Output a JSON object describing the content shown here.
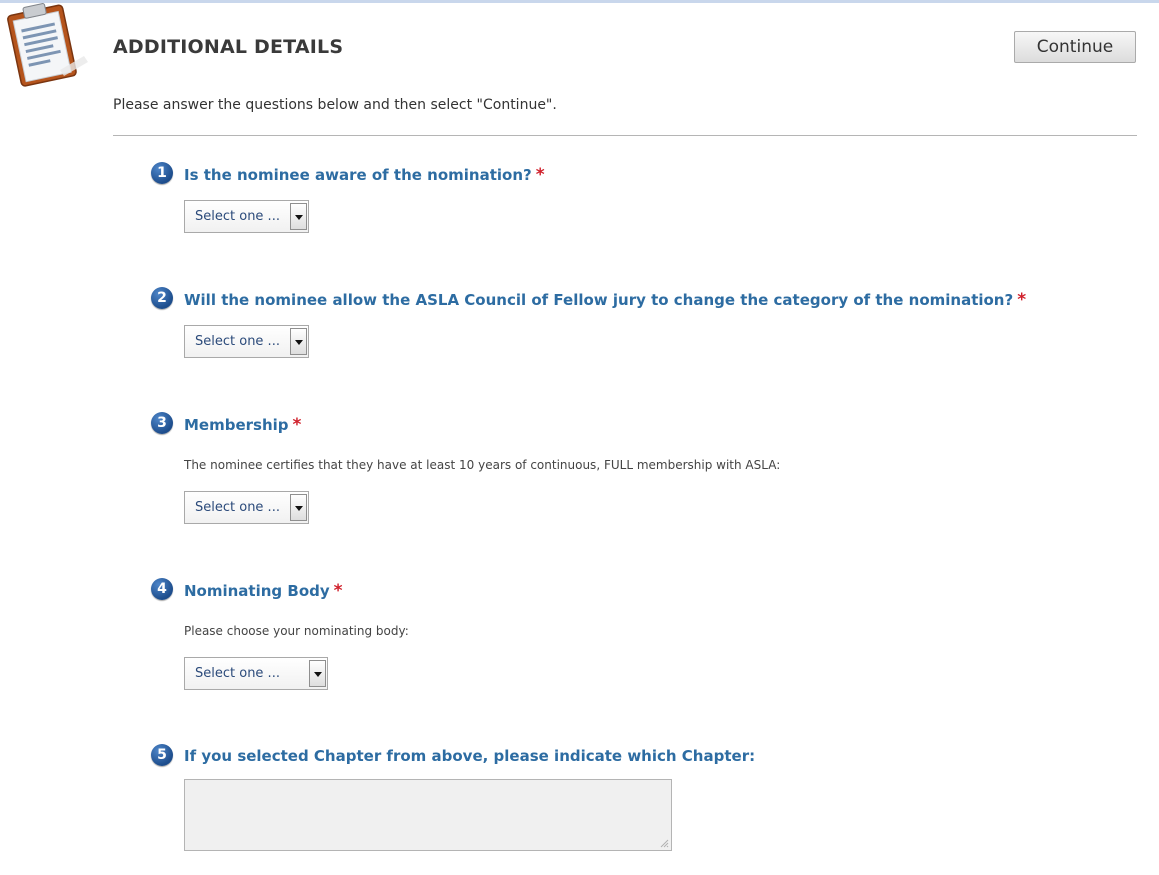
{
  "header": {
    "title": "ADDITIONAL DETAILS",
    "continue_label": "Continue",
    "intro": "Please answer the questions below and then select \"Continue\"."
  },
  "colors": {
    "question_text": "#2d6ca2",
    "required_star": "#d0202b",
    "badge": "#1d4d8c"
  },
  "questions": [
    {
      "number": "1",
      "label": "Is the nominee aware of the nomination?",
      "required": "*",
      "select_value": "Select one ..."
    },
    {
      "number": "2",
      "label": "Will the nominee allow the ASLA Council of Fellow jury to change the category of the nomination?",
      "required": "*",
      "select_value": "Select one ..."
    },
    {
      "number": "3",
      "label": "Membership",
      "required": "*",
      "description": "The nominee certifies that they have at least 10 years of continuous, FULL membership with ASLA:",
      "select_value": "Select one ..."
    },
    {
      "number": "4",
      "label": "Nominating Body",
      "required": "*",
      "description": "Please choose your nominating body:",
      "select_value": "Select one ..."
    },
    {
      "number": "5",
      "label": "If you selected Chapter from above, please indicate which Chapter:",
      "textarea_value": ""
    }
  ]
}
